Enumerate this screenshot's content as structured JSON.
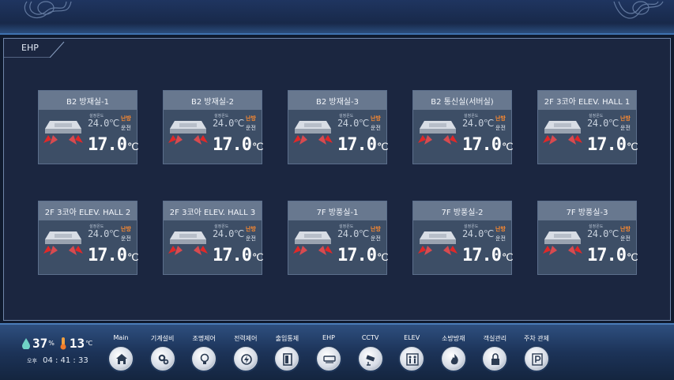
{
  "panel": {
    "title": "EHP"
  },
  "units": [
    {
      "name": "B2 방재실-1",
      "set_label": "설정온도",
      "set_temp": "24.0℃",
      "mode": "난방",
      "status": "운전",
      "current_temp": "17.0",
      "current_unit": "℃"
    },
    {
      "name": "B2 방재실-2",
      "set_label": "설정온도",
      "set_temp": "24.0℃",
      "mode": "난방",
      "status": "운전",
      "current_temp": "17.0",
      "current_unit": "℃"
    },
    {
      "name": "B2 방재실-3",
      "set_label": "설정온도",
      "set_temp": "24.0℃",
      "mode": "난방",
      "status": "운전",
      "current_temp": "17.0",
      "current_unit": "℃"
    },
    {
      "name": "B2 통신실(서버실)",
      "set_label": "설정온도",
      "set_temp": "24.0℃",
      "mode": "난방",
      "status": "운전",
      "current_temp": "17.0",
      "current_unit": "℃"
    },
    {
      "name": "2F 3코아 ELEV. HALL 1",
      "set_label": "설정온도",
      "set_temp": "24.0℃",
      "mode": "난방",
      "status": "운전",
      "current_temp": "17.0",
      "current_unit": "℃"
    },
    {
      "name": "2F 3코아 ELEV. HALL 2",
      "set_label": "설정온도",
      "set_temp": "24.0℃",
      "mode": "난방",
      "status": "운전",
      "current_temp": "17.0",
      "current_unit": "℃"
    },
    {
      "name": "2F 3코아 ELEV. HALL 3",
      "set_label": "설정온도",
      "set_temp": "24.0℃",
      "mode": "난방",
      "status": "운전",
      "current_temp": "17.0",
      "current_unit": "℃"
    },
    {
      "name": "7F 방풍실-1",
      "set_label": "설정온도",
      "set_temp": "24.0℃",
      "mode": "난방",
      "status": "운전",
      "current_temp": "17.0",
      "current_unit": "℃"
    },
    {
      "name": "7F 방풍실-2",
      "set_label": "설정온도",
      "set_temp": "24.0℃",
      "mode": "난방",
      "status": "운전",
      "current_temp": "17.0",
      "current_unit": "℃"
    },
    {
      "name": "7F 방풍실-3",
      "set_label": "설정온도",
      "set_temp": "24.0℃",
      "mode": "난방",
      "status": "운전",
      "current_temp": "17.0",
      "current_unit": "℃"
    }
  ],
  "footer": {
    "humidity": "37",
    "humidity_unit": "%",
    "temperature": "13",
    "temperature_unit": "℃",
    "ampm": "오후",
    "time": "04 : 41 : 33",
    "nav": [
      {
        "label": "Main",
        "icon": "home-icon"
      },
      {
        "label": "기계설비",
        "icon": "gears-icon"
      },
      {
        "label": "조명제어",
        "icon": "bulb-icon"
      },
      {
        "label": "전력제어",
        "icon": "power-icon"
      },
      {
        "label": "출입통제",
        "icon": "door-icon"
      },
      {
        "label": "EHP",
        "icon": "aircon-icon"
      },
      {
        "label": "CCTV",
        "icon": "camera-icon"
      },
      {
        "label": "ELEV",
        "icon": "elevator-icon"
      },
      {
        "label": "소방방재",
        "icon": "fire-icon"
      },
      {
        "label": "객실관리",
        "icon": "lock-icon"
      },
      {
        "label": "주차 관제",
        "icon": "parking-icon"
      }
    ]
  },
  "colors": {
    "mode": "#ff8a2e",
    "panel_bg": "#1b2640",
    "card_bg": "#3d4e66",
    "card_title_bg": "#68788f"
  }
}
